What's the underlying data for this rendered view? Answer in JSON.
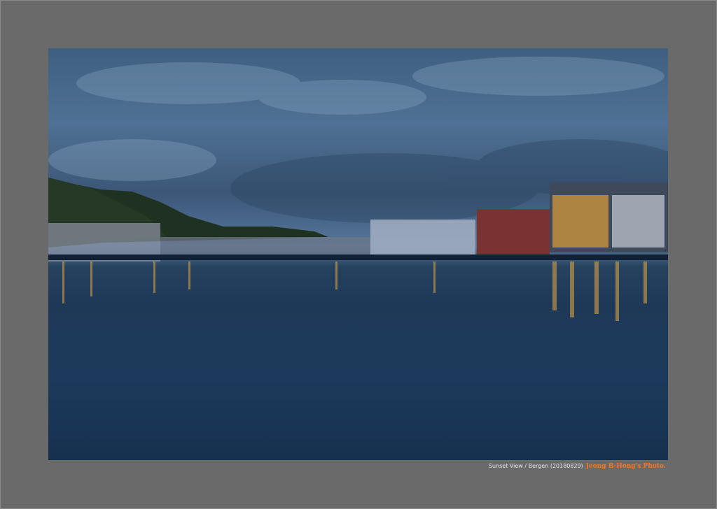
{
  "photo": {
    "subject": "Bergen harbour at dusk"
  },
  "caption": {
    "text": "Sunset View / Bergen  (20180829)",
    "credit": "Jeong B-Hong's Photo."
  },
  "colors": {
    "frame": "#6a6a6a",
    "credit": "#f07a2a"
  }
}
